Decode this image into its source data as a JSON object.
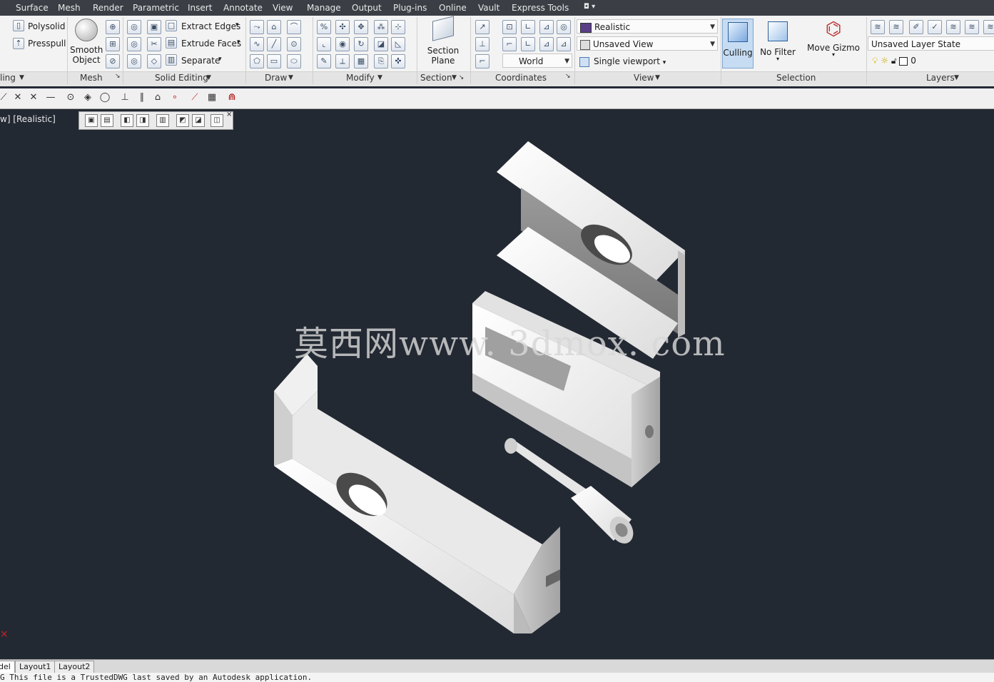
{
  "menu": [
    "Surface",
    "Mesh",
    "Render",
    "Parametric",
    "Insert",
    "Annotate",
    "View",
    "Manage",
    "Output",
    "Plug-ins",
    "Online",
    "Vault",
    "Express Tools"
  ],
  "ribbon": {
    "modeling": {
      "polysolid": "Polysolid",
      "presspull": "Presspull",
      "title": "ling"
    },
    "mesh": {
      "smooth": "Smooth\nObject",
      "smooth_line1": "Smooth",
      "smooth_line2": "Object",
      "title": "Mesh"
    },
    "solid_editing": {
      "extract": "Extract Edges",
      "extrude": "Extrude Faces",
      "separate": "Separate",
      "title": "Solid Editing"
    },
    "draw": {
      "title": "Draw"
    },
    "modify": {
      "title": "Modify"
    },
    "section": {
      "line1": "Section",
      "line2": "Plane",
      "title": "Section"
    },
    "coordinates": {
      "world": "World",
      "title": "Coordinates"
    },
    "view": {
      "visual_style": "Realistic",
      "named_view": "Unsaved View",
      "viewport": "Single viewport",
      "title": "View"
    },
    "selection": {
      "culling": "Culling",
      "no_filter": "No Filter",
      "move_gizmo": "Move Gizmo",
      "title": "Selection"
    },
    "layers": {
      "layer_state": "Unsaved Layer State",
      "layer_name": "0",
      "title": "Layers"
    }
  },
  "viewport": {
    "label": "w] [Realistic]"
  },
  "watermark": "莫西网www. 3dmox. com",
  "tabs": [
    "del",
    "Layout1",
    "Layout2"
  ],
  "cmdline": "G   This file is a TrustedDWG last saved by an Autodesk application.",
  "colors": {
    "viewport_bg": "#232933",
    "model_face": "#e9e9e9",
    "model_shadow": "#8d8d8d"
  }
}
